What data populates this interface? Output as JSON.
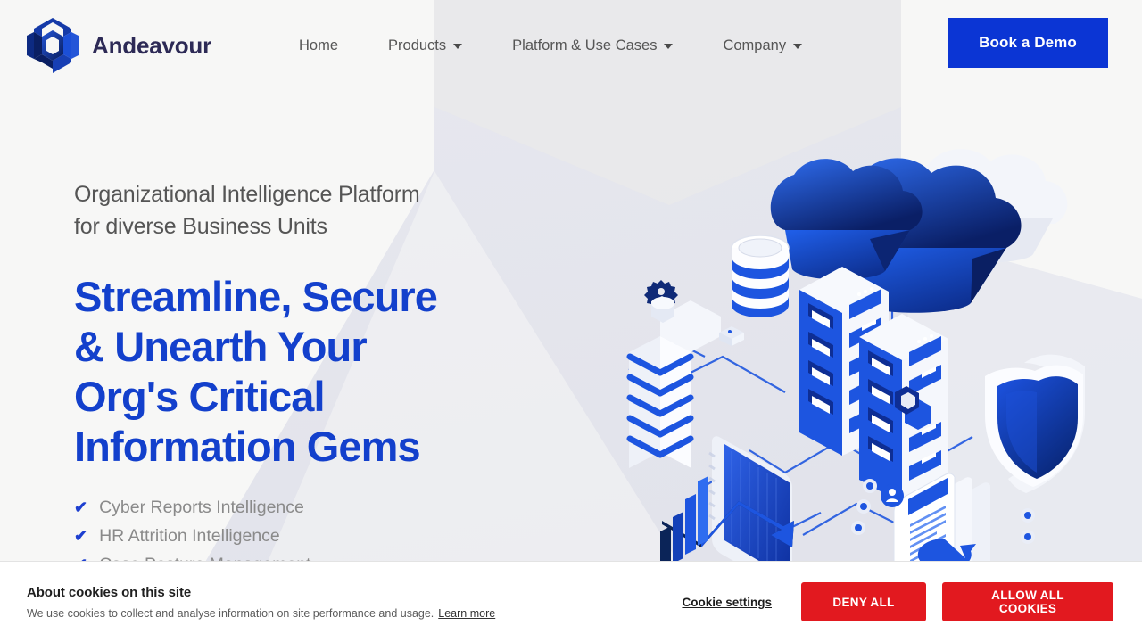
{
  "brand": {
    "name": "Andeavour",
    "logo_icon": "hex-cube-logo-icon"
  },
  "nav": {
    "items": [
      {
        "label": "Home",
        "has_dropdown": false
      },
      {
        "label": "Products",
        "has_dropdown": true
      },
      {
        "label": "Platform & Use Cases",
        "has_dropdown": true
      },
      {
        "label": "Company",
        "has_dropdown": true
      }
    ],
    "cta": {
      "label": "Book a Demo",
      "color": "#0b35d4"
    }
  },
  "hero": {
    "eyebrow_line1": "Organizational Intelligence Platform",
    "eyebrow_line2": "for diverse Business Units",
    "headline_line1": "Streamline, Secure",
    "headline_line2": "& Unearth Your",
    "headline_line3": "Org's Critical",
    "headline_line4": "Information Gems",
    "headline_color": "#1340cc",
    "features": [
      {
        "label": "Cyber Reports Intelligence",
        "icon": "check-icon"
      },
      {
        "label": "HR Attrition Intelligence",
        "icon": "check-icon"
      },
      {
        "label": "Case Posture Management",
        "icon": "check-icon"
      }
    ]
  },
  "illustration": {
    "name": "isometric-data-platform-illustration",
    "elements": [
      "cloud",
      "cloud",
      "database-cylinder",
      "server-rack",
      "server-rack",
      "shield-icon",
      "chart-monitor",
      "document-cards",
      "gear-icon",
      "chevron-stack"
    ]
  },
  "cookie_banner": {
    "title": "About cookies on this site",
    "description": "We use cookies to collect and analyse information on site performance and usage.",
    "learn_more": "Learn more",
    "settings_label": "Cookie settings",
    "deny_label": "DENY ALL",
    "allow_label": "ALLOW ALL COOKIES",
    "button_color": "#e2191f"
  }
}
